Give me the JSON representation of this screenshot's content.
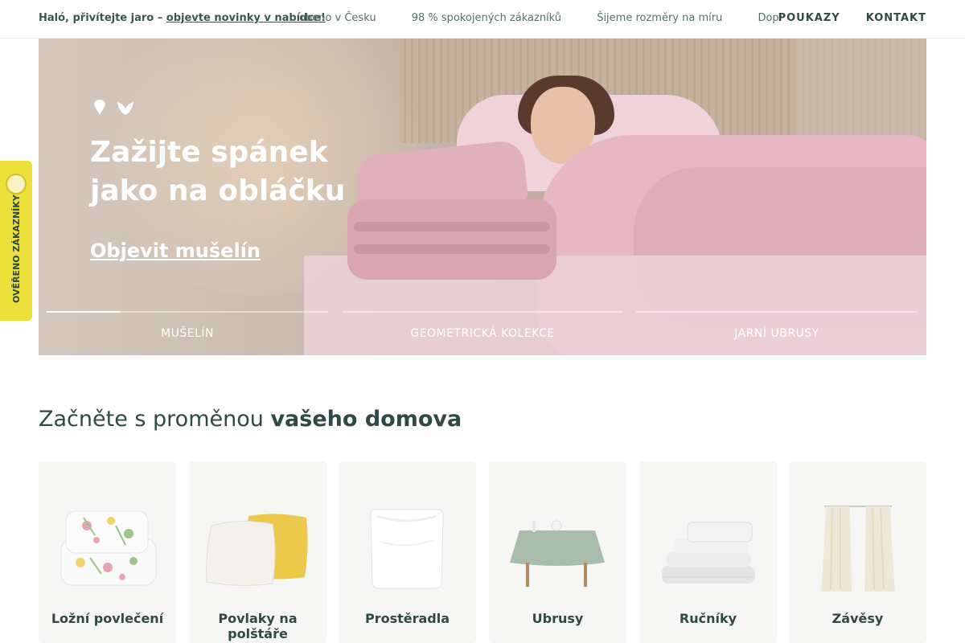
{
  "topbar": {
    "promo_text": " Haló, přivítejte jaro – ",
    "promo_link": "objevte novinky v nabídce!",
    "ticker": [
      "obeno v Česku",
      "98 % spokojených zákazníků",
      "Šijeme rozměry na míru",
      "Doprava"
    ],
    "nav": [
      "POUKAZY",
      "KONTAKT"
    ]
  },
  "hero": {
    "title_line1": "Zažijte spánek",
    "title_line2": "jako na obláčku",
    "cta": "Objevit mušelín",
    "tabs": [
      {
        "label": "MUŠELÍN",
        "progress": 0.26
      },
      {
        "label": "GEOMETRICKÁ KOLEKCE",
        "progress": 0
      },
      {
        "label": "JARNÍ UBRUSY",
        "progress": 0
      }
    ]
  },
  "side_badge": {
    "label": "OVĚŘENO ZÁKAZNÍKY"
  },
  "section": {
    "title_regular": "Začněte s proměnou ",
    "title_bold": "vašeho domova"
  },
  "categories": [
    {
      "label": "Ložní povlečení",
      "icon": "bedding-icon"
    },
    {
      "label": "Povlaky na polštáře",
      "icon": "pillowcase-icon"
    },
    {
      "label": "Prostěradla",
      "icon": "sheet-icon"
    },
    {
      "label": "Ubrusy",
      "icon": "tablecloth-icon"
    },
    {
      "label": "Ručníky",
      "icon": "towels-icon"
    },
    {
      "label": "Závěsy",
      "icon": "curtains-icon"
    }
  ]
}
